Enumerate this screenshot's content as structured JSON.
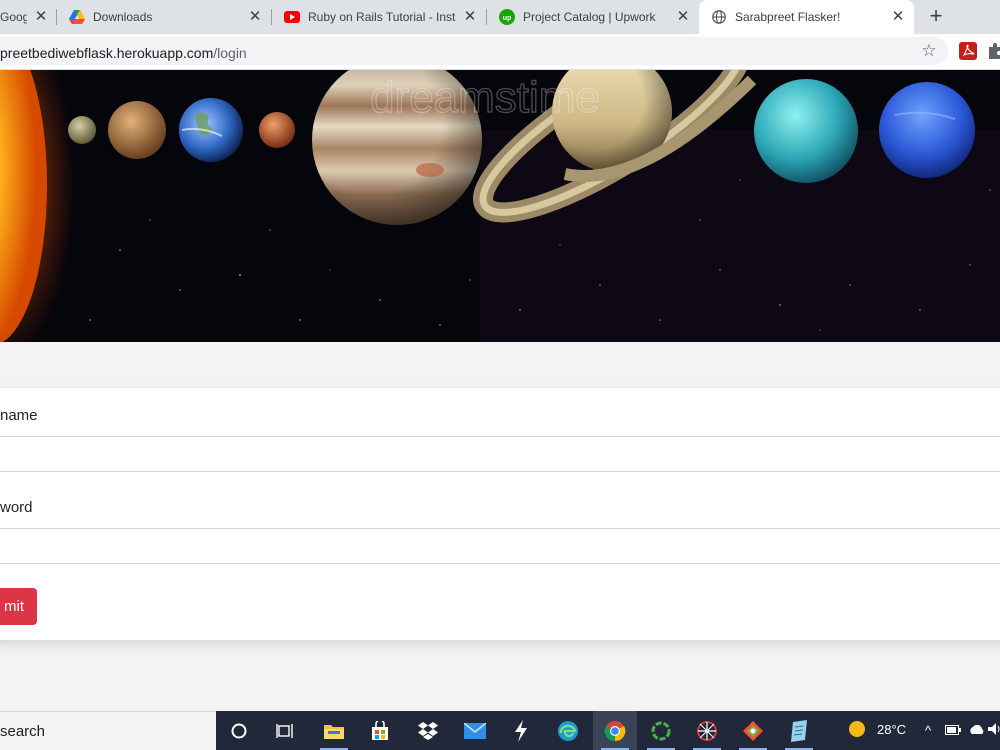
{
  "browser": {
    "tabs": [
      {
        "title": "Google Se",
        "icon": "google-icon",
        "active": false
      },
      {
        "title": "Downloads",
        "icon": "google-drive-icon",
        "active": false
      },
      {
        "title": "Ruby on Rails Tutorial - Insta",
        "icon": "youtube-icon",
        "active": false
      },
      {
        "title": "Project Catalog | Upwork",
        "icon": "upwork-icon",
        "active": false
      },
      {
        "title": "Sarabpreet Flasker!",
        "icon": "globe-icon",
        "active": true
      }
    ],
    "tab_close_glyph": "✕",
    "new_tab_glyph": "+",
    "url_host": "preetbediwebflask.herokuapp.com",
    "url_path": "/login",
    "star_glyph": "☆",
    "extensions": [
      "acrobat-pdf-icon",
      "puzzle-extensions-icon"
    ]
  },
  "banner": {
    "description_text": "",
    "watermark": "dreamstime"
  },
  "form": {
    "username_label": "name",
    "username_value": "",
    "password_label": "word",
    "password_value": "",
    "submit_label": "mit",
    "submit_color": "#dc3545"
  },
  "taskbar": {
    "search_text": "search",
    "apps": [
      "cortana-icon",
      "task-view-icon",
      "file-explorer-icon",
      "microsoft-store-icon",
      "dropbox-icon",
      "mail-icon",
      "sublime-lightning-icon",
      "edge-icon",
      "chrome-icon",
      "spinner-app-icon",
      "network-app-icon",
      "git-kraken-icon",
      "notepad-icon"
    ],
    "weather_temp": "28°C",
    "tray_chevron": "^"
  },
  "colors": {
    "tabstrip": "#dee1e6",
    "taskbar": "#21283a",
    "danger": "#dc3545"
  }
}
